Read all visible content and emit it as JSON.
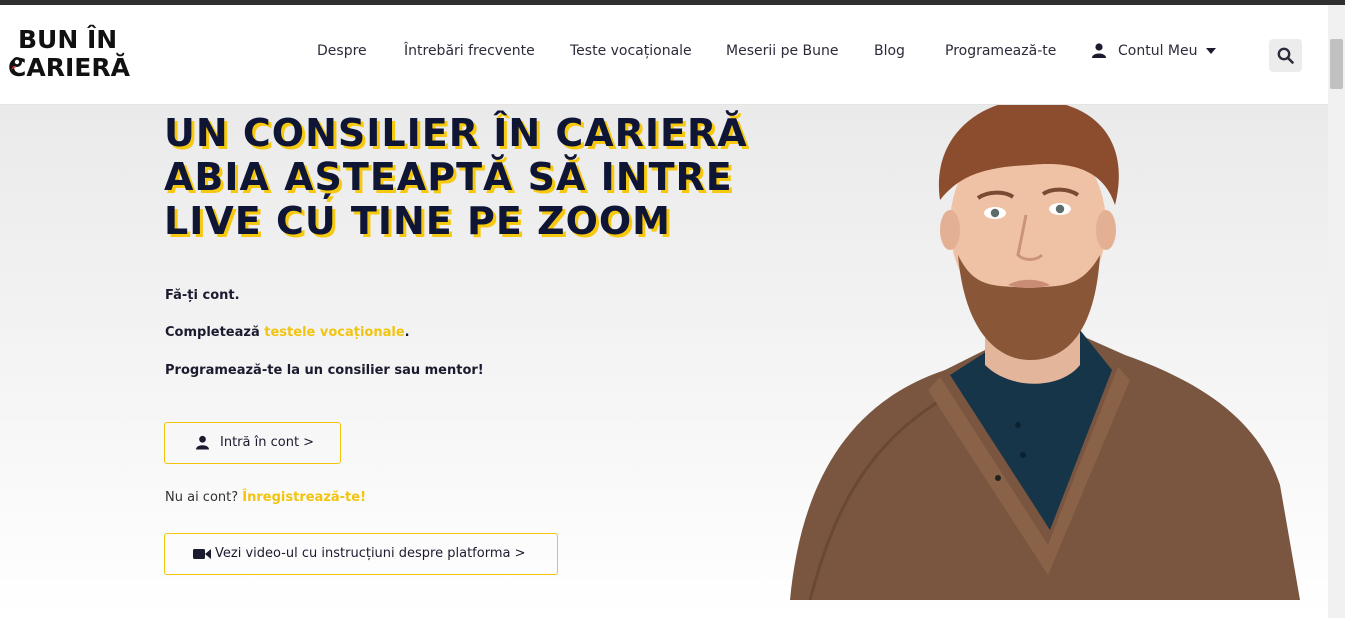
{
  "header": {
    "logo": {
      "line1": "BUN ÎN",
      "line2": "CARIERĂ"
    },
    "nav": [
      {
        "label": "Despre"
      },
      {
        "label": "Întrebări frecvente"
      },
      {
        "label": "Teste vocaționale"
      },
      {
        "label": "Meserii pe Bune"
      },
      {
        "label": "Blog"
      },
      {
        "label": "Programează-te"
      }
    ],
    "account": {
      "label": "Contul Meu",
      "icon": "user-icon"
    },
    "search": {
      "icon": "search-icon"
    }
  },
  "hero": {
    "title_lines": [
      "UN CONSILIER ÎN CARIERĂ",
      "ABIA AȘTEAPTĂ SĂ INTRE",
      "LIVE CU TINE PE ZOOM"
    ],
    "steps": {
      "step1": "Fă-ți cont.",
      "step2_prefix": "Completează ",
      "step2_link": "testele vocaționale",
      "step2_suffix": ".",
      "step3": "Programează-te la un consilier sau mentor!"
    },
    "login_button": {
      "label": "Intră în cont >",
      "icon": "user-icon"
    },
    "register": {
      "prefix": "Nu ai cont? ",
      "link": "Înregistrează-te!"
    },
    "video_button": {
      "label": "Vezi video-ul cu instrucțiuni despre platforma >",
      "icon": "video-camera-icon"
    }
  },
  "colors": {
    "accent": "#f2c40f",
    "title": "#0f1535",
    "text": "#1b1b2f"
  }
}
